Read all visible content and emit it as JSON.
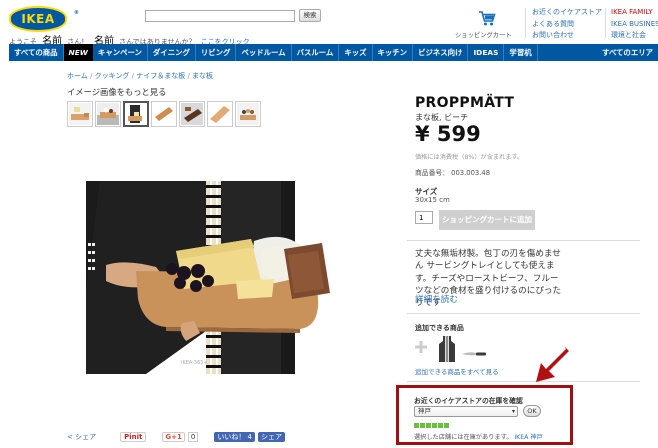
{
  "header": {
    "logo_text": "IKEA",
    "welcome_prefix": "ようこそ",
    "welcome_name": "名前",
    "welcome_suffix": "さん！",
    "alt_name": "名前",
    "alt_text": "さんではありませんか？",
    "alt_link": "ここをクリック",
    "search_button": "検索",
    "cart_label": "ショッピングカート",
    "links_col1": [
      "お近くのイケアストア",
      "よくある質問",
      "お問い合わせ"
    ],
    "links_col2": [
      "IKEA FAMILY",
      "IKEA BUSINESS",
      "環境と社会"
    ]
  },
  "nav": {
    "items": [
      "すべての商品",
      "NEW",
      "キャンペーン",
      "ダイニング",
      "リビング",
      "ベッドルーム",
      "バスルーム",
      "キッズ",
      "キッチン",
      "ビジネス向け",
      "IDEAS",
      "学習机"
    ],
    "right": "すべてのエリア"
  },
  "breadcrumb": [
    "ホーム",
    "クッキング",
    "ナイフ＆まな板",
    "まな板"
  ],
  "gallery": {
    "heading": "イメージ画像をもっと見る"
  },
  "product": {
    "name": "PROPPMÄTT",
    "subtitle": "まな板, ビーチ",
    "price": "¥ 599",
    "tax_note": "価格には消費税（8%）が含まれます。",
    "item_no": "商品番号： 003.003.48",
    "size_label": "サイズ",
    "size_value": "30x15 cm",
    "qty": "1",
    "add_to_cart": "ショッピングカートに追加",
    "description": "丈夫な無垢材製。包丁の刃を傷めません サービングトレイとしても使えます。チーズやローストビーフ、フルーツなどの食材を盛り付けるのにぴったりです",
    "more_link": "詳細を読む"
  },
  "accessories": {
    "title": "追加できる商品",
    "link": "追加できる商品をすべて見る"
  },
  "stock": {
    "title": "お近くのイケアストアの在庫を確認",
    "store": "神戸",
    "ok": "OK",
    "status": "選択した店舗には在庫があります。",
    "status_link": "IKEA 神戸",
    "status_color": "#6cbf3e"
  },
  "social": {
    "share": "シェア",
    "pinit": "Pinit",
    "gplus": "G+1",
    "gcount": "0",
    "like": "いいね！ 4",
    "fb_share": "シェア"
  },
  "colors": {
    "brand_blue": "#0058a3",
    "brand_yellow": "#ffdb00",
    "family_red": "#cc0008",
    "highlight": "#a01010"
  }
}
